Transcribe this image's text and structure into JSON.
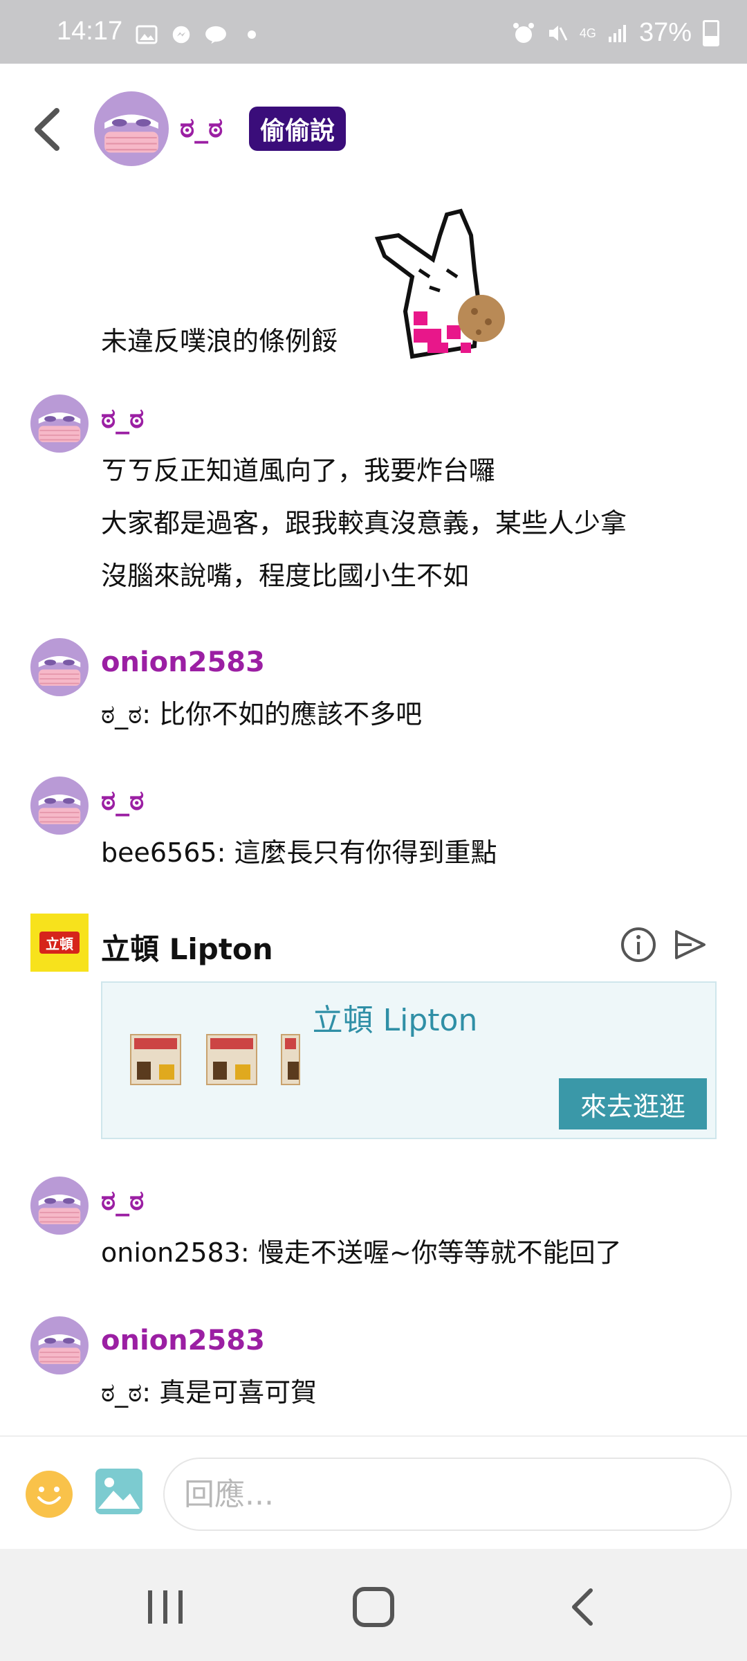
{
  "status_bar": {
    "time": "14:17",
    "battery": "37%",
    "network": "4G"
  },
  "header": {
    "author_name": "ಠ_ಠ",
    "tag": "偷偷說"
  },
  "plurk": {
    "text": "未違反噗浪的條例餒"
  },
  "responses": [
    {
      "name": "ಠ_ಠ",
      "lines": [
        "ㄎㄎ反正知道風向了，我要炸台囉",
        "大家都是過客，跟我較真沒意義，某些人少拿",
        "沒腦來說嘴，程度比國小生不如"
      ]
    },
    {
      "name": "onion2583",
      "lines": [
        "ಠ_ಠ: 比你不如的應該不多吧"
      ]
    },
    {
      "name": "ಠ_ಠ",
      "lines": [
        "bee6565: 這麼長只有你得到重點"
      ]
    },
    {
      "name": "ಠ_ಠ",
      "lines": [
        "onion2583: 慢走不送喔~你等等就不能回了"
      ]
    },
    {
      "name": "onion2583",
      "lines": [
        "ಠ_ಠ: 真是可喜可賀"
      ]
    }
  ],
  "ad": {
    "logo_text": "立頓",
    "title": "立頓 Lipton",
    "box_title": "立頓 Lipton",
    "cta": "來去逛逛"
  },
  "composer": {
    "placeholder": "回應..."
  }
}
